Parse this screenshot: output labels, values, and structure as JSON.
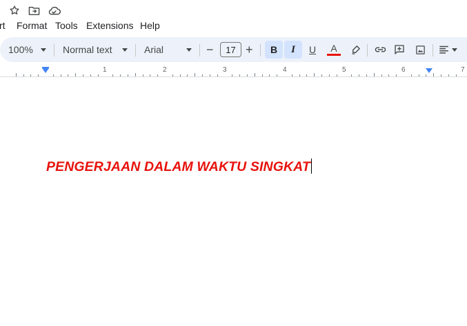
{
  "title_icons": [
    "star-icon",
    "move-to-folder-icon",
    "cloud-saved-icon"
  ],
  "menu": {
    "insert_partial": "rt",
    "format": "Format",
    "tools": "Tools",
    "extensions": "Extensions",
    "help": "Help"
  },
  "toolbar": {
    "zoom": "100%",
    "style": "Normal text",
    "font": "Arial",
    "font_size": "17",
    "minus": "−",
    "plus": "+",
    "bold": "B",
    "italic": "I",
    "underline": "U",
    "text_color": "A",
    "text_color_value": "#e8120c"
  },
  "ruler": {
    "labels": [
      "1",
      "2",
      "3",
      "4",
      "5",
      "6",
      "7"
    ]
  },
  "document": {
    "text": "PENGERJAAN DALAM WAKTU SINGKAT",
    "text_color": "#e8120c",
    "bold": true,
    "italic": true
  }
}
